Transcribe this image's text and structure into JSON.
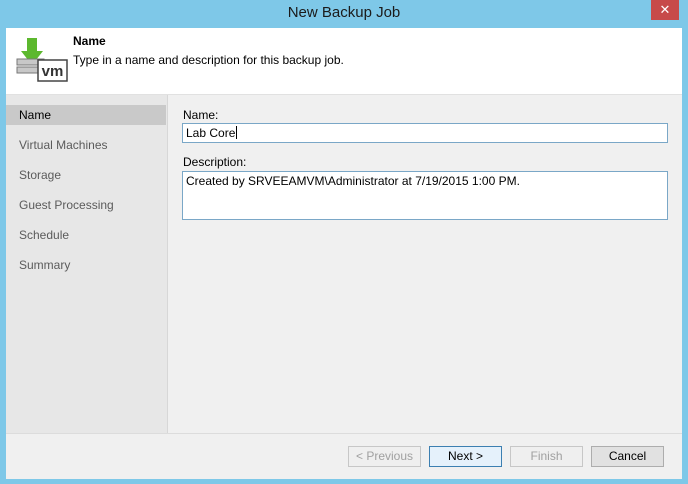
{
  "window": {
    "title": "New Backup Job",
    "close_glyph": "✕"
  },
  "header": {
    "title": "Name",
    "description": "Type in a name and description for this backup job.",
    "icon": "vm-backup-icon",
    "icon_text": "vm"
  },
  "sidebar": {
    "items": [
      {
        "label": "Name",
        "active": true
      },
      {
        "label": "Virtual Machines",
        "active": false
      },
      {
        "label": "Storage",
        "active": false
      },
      {
        "label": "Guest Processing",
        "active": false
      },
      {
        "label": "Schedule",
        "active": false
      },
      {
        "label": "Summary",
        "active": false
      }
    ]
  },
  "form": {
    "name_label": "Name:",
    "name_value": "Lab Core",
    "description_label": "Description:",
    "description_value": "Created by SRVEEAMVM\\Administrator at 7/19/2015 1:00 PM."
  },
  "buttons": {
    "previous": "< Previous",
    "next": "Next >",
    "finish": "Finish",
    "cancel": "Cancel"
  },
  "colors": {
    "titlebar": "#7ec8e8",
    "close": "#c74a4a",
    "active_step": "#c9c9c9",
    "icon_green": "#5cb82e"
  }
}
